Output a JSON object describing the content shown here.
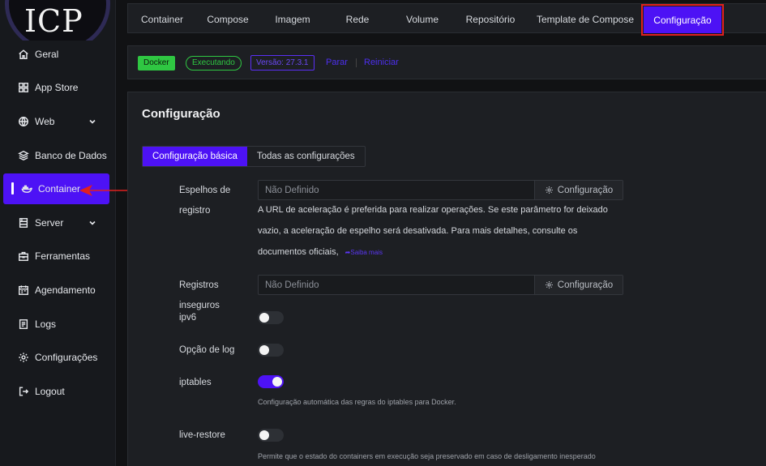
{
  "logo": {
    "text": "ICP"
  },
  "sidebar": {
    "items": [
      {
        "label": "Geral",
        "icon": "home-icon"
      },
      {
        "label": "App Store",
        "icon": "grid-icon"
      },
      {
        "label": "Web",
        "icon": "globe-icon",
        "expandable": true
      },
      {
        "label": "Banco de Dados",
        "icon": "layers-icon"
      },
      {
        "label": "Container",
        "icon": "docker-icon",
        "active": true
      },
      {
        "label": "Server",
        "icon": "server-icon",
        "expandable": true
      },
      {
        "label": "Ferramentas",
        "icon": "toolbox-icon"
      },
      {
        "label": "Agendamento",
        "icon": "calendar-icon"
      },
      {
        "label": "Logs",
        "icon": "logs-icon"
      },
      {
        "label": "Configurações",
        "icon": "gear-icon"
      },
      {
        "label": "Logout",
        "icon": "logout-icon"
      }
    ]
  },
  "tabs": [
    {
      "label": "Container"
    },
    {
      "label": "Compose"
    },
    {
      "label": "Imagem"
    },
    {
      "label": "Rede"
    },
    {
      "label": "Volume"
    },
    {
      "label": "Repositório"
    },
    {
      "label": "Template de Compose"
    },
    {
      "label": "Configuração",
      "active": true
    }
  ],
  "status": {
    "docker_label": "Docker",
    "state_label": "Executando",
    "version_label": "Versão: 27.3.1",
    "stop_label": "Parar",
    "restart_label": "Reiniciar"
  },
  "panel": {
    "title": "Configuração",
    "segments": [
      {
        "label": "Configuração básica",
        "active": true
      },
      {
        "label": "Todas as configurações"
      }
    ],
    "mirrors": {
      "label_line1": "Espelhos de",
      "label_line2": "registro",
      "placeholder": "Não Definido",
      "button_label": "Configuração",
      "desc_line1": "A URL de aceleração é preferida para realizar operações. Se este parâmetro for deixado",
      "desc_line2": "vazio, a aceleração de espelho será desativada. Para mais detalhes, consulte os",
      "desc_line3": "documentos oficiais,",
      "learn_more": "Saiba mais"
    },
    "insecure": {
      "label_line1": "Registros",
      "label_line2": "inseguros",
      "placeholder": "Não Definido",
      "button_label": "Configuração"
    },
    "ipv6": {
      "label": "ipv6",
      "enabled": false
    },
    "log_option": {
      "label": "Opção de log",
      "enabled": false
    },
    "iptables": {
      "label": "iptables",
      "enabled": true,
      "hint": "Configuração automática das regras do iptables para Docker."
    },
    "live_restore": {
      "label": "live-restore",
      "enabled": false,
      "hint": "Permite que o estado do containers em execução seja preservado em caso de desligamento inesperado"
    }
  },
  "colors": {
    "accent": "#4d12f5",
    "success": "#2fc742",
    "highlight_box": "#e0201f",
    "annotation_arrow": "#e0201f"
  }
}
